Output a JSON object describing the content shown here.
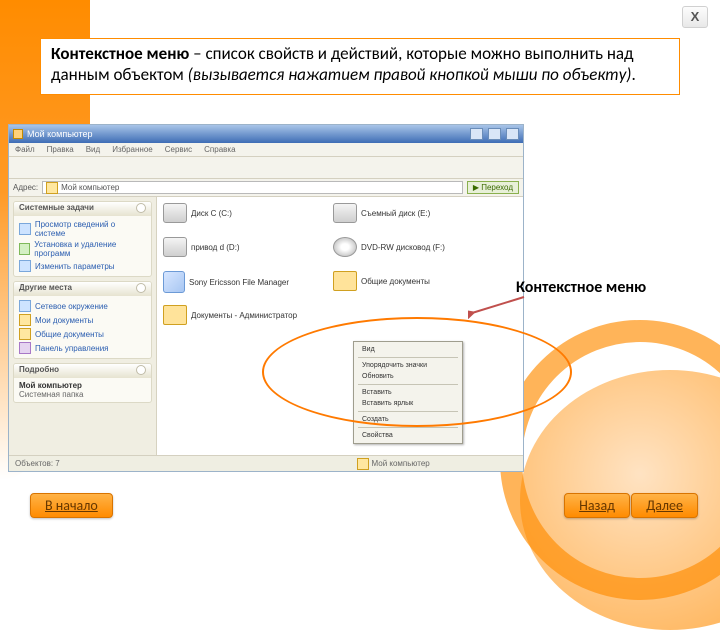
{
  "close": "X",
  "definition": {
    "term": "Контекстное меню",
    "sep": " – ",
    "text1": "список свойств и действий, которые можно выполнить над данным объектом ",
    "italic": "(вызывается нажатием правой кнопкой мыши по объекту)",
    "dot": "."
  },
  "callout": "Контекстное меню",
  "nav": {
    "start": "В начало",
    "back": "Назад",
    "next": "Далее"
  },
  "xp": {
    "title": "Мой компьютер",
    "menu": [
      "Файл",
      "Правка",
      "Вид",
      "Избранное",
      "Сервис",
      "Справка"
    ],
    "addr_label": "Адрес:",
    "addr_value": "Мой компьютер",
    "go": "Переход",
    "side": {
      "g1": {
        "head": "Системные задачи",
        "items": [
          "Просмотр сведений о системе",
          "Установка и удаление программ",
          "Изменить параметры"
        ]
      },
      "g2": {
        "head": "Другие места",
        "items": [
          "Сетевое окружение",
          "Мои документы",
          "Общие документы",
          "Панель управления"
        ]
      },
      "g3": {
        "head": "Подробно",
        "sub1": "Мой компьютер",
        "sub2": "Системная папка"
      }
    },
    "drives": {
      "c": "Диск C (C:)",
      "d": "привод d (D:)",
      "e": "Съемный диск (E:)",
      "dvd": "DVD-RW дисковод (F:)",
      "docs": "Sony Ericsson File Manager",
      "shared": "Общие документы",
      "user": "Документы - Администратор"
    },
    "context": [
      "Вид",
      "Упорядочить значки",
      "Обновить",
      "Вставить",
      "Вставить ярлык",
      "Создать",
      "Свойства"
    ],
    "status": {
      "left": "Объектов: 7",
      "right": "Мой компьютер"
    }
  }
}
